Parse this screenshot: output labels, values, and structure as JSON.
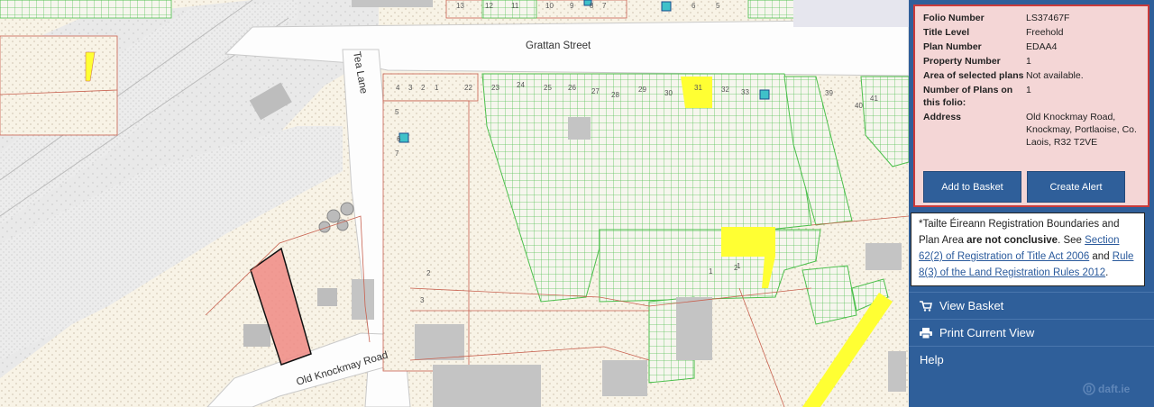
{
  "map": {
    "streets": {
      "grattan": "Grattan Street",
      "tea_lane": "Tea Lane",
      "old_knockmay": "Old Knockmay Road"
    },
    "plot_numbers": [
      "13",
      "12",
      "11",
      "10",
      "9",
      "8",
      "7",
      "6",
      "5",
      "4",
      "3",
      "2",
      "1",
      "22",
      "23",
      "24",
      "25",
      "26",
      "27",
      "28",
      "29",
      "30",
      "31",
      "32",
      "33",
      "39",
      "40",
      "41",
      "5",
      "6",
      "7",
      "2",
      "3",
      "1",
      "2",
      "1"
    ]
  },
  "folio": {
    "rows": [
      {
        "label": "Folio Number",
        "value": "LS37467F"
      },
      {
        "label": "Title Level",
        "value": "Freehold"
      },
      {
        "label": "Plan Number",
        "value": "EDAA4"
      },
      {
        "label": "Property Number",
        "value": "1"
      },
      {
        "label": "Area of selected plans",
        "value": "Not available."
      },
      {
        "label": "Number of Plans on this folio:",
        "value": "1"
      },
      {
        "label": "Address",
        "value": "Old Knockmay Road, Knockmay, Portlaoise, Co. Laois, R32 T2VE"
      }
    ],
    "add_basket_label": "Add to Basket",
    "create_alert_label": "Create Alert"
  },
  "notice": {
    "prefix": "*Tailte Éireann Registration Boundaries and Plan Area ",
    "bold": "are not conclusive",
    "mid": ". See ",
    "link1": "Section 62(2) of Registration of Title Act 2006",
    "and": " and ",
    "link2": "Rule 8(3) of the Land Registration Rules 2012",
    "end": "."
  },
  "menu": {
    "view_basket": "View Basket",
    "print_view": "Print Current View",
    "help": "Help"
  },
  "watermark": "daft.ie",
  "colors": {
    "panel_bg": "#2f5f9a",
    "info_bg": "#f4d6d6",
    "info_border": "#c93a3a",
    "parcel_green": "#4cbf4c",
    "highlight_yellow": "#ffff33",
    "selected_red": "#f08a84"
  }
}
